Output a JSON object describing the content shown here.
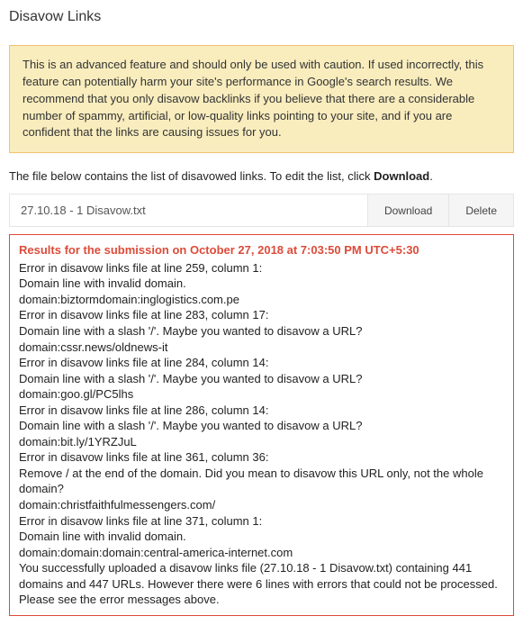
{
  "page": {
    "title": "Disavow Links"
  },
  "warning": {
    "text": "This is an advanced feature and should only be used with caution. If used incorrectly, this feature can potentially harm your site's performance in Google's search results. We recommend that you only disavow backlinks if you believe that there are a considerable number of spammy, artificial, or low-quality links pointing to your site, and if you are confident that the links are causing issues for you."
  },
  "intro": {
    "prefix": "The file below contains the list of disavowed links. To edit the list, click ",
    "bold": "Download",
    "suffix": "."
  },
  "file": {
    "name": "27.10.18 - 1 Disavow.txt",
    "download_label": "Download",
    "delete_label": "Delete"
  },
  "results": {
    "header": "Results for the submission on October 27, 2018 at 7:03:50 PM UTC+5:30",
    "lines": [
      "Error in disavow links file at line 259, column 1:",
      "Domain line with invalid domain.",
      "domain:biztormdomain:inglogistics.com.pe",
      "Error in disavow links file at line 283, column 17:",
      "Domain line with a slash '/'. Maybe you wanted to disavow a URL?",
      "domain:cssr.news/oldnews-it",
      "Error in disavow links file at line 284, column 14:",
      "Domain line with a slash '/'. Maybe you wanted to disavow a URL?",
      "domain:goo.gl/PC5lhs",
      "Error in disavow links file at line 286, column 14:",
      "Domain line with a slash '/'. Maybe you wanted to disavow a URL?",
      "domain:bit.ly/1YRZJuL",
      "Error in disavow links file at line 361, column 36:",
      "Remove / at the end of the domain. Did you mean to disavow this URL only, not the whole domain?",
      "domain:christfaithfulmessengers.com/",
      "Error in disavow links file at line 371, column 1:",
      "Domain line with invalid domain.",
      "domain:domain:domain:central-america-internet.com",
      "You successfully uploaded a disavow links file (27.10.18 - 1 Disavow.txt) containing 441 domains and 447 URLs. However there were 6 lines with errors that could not be processed. Please see the error messages above."
    ]
  }
}
